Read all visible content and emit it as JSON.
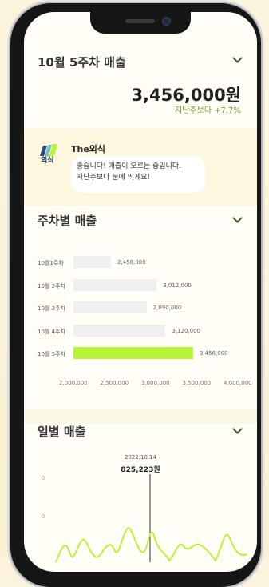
{
  "weekly_summary": {
    "title": "10월 5주차 매출",
    "amount": "3,456,000원",
    "growth": "지난주보다 +7.7%"
  },
  "assistant": {
    "name": "The외식",
    "logo_text": "외식",
    "message_line1": "좋습니다! 매출이 오르는 중입니다.",
    "message_line2": "지난주보다 눈에 띄게요!"
  },
  "weekly_chart": {
    "title": "주차별 매출",
    "axis_ticks": [
      "2,000,000",
      "2,500,000",
      "3,000,000",
      "3,500,000",
      "4,000,000"
    ],
    "highlight_color": "#b8f53a",
    "bar_color": "#efefef"
  },
  "daily_chart": {
    "title": "일별 매출",
    "tooltip_date": "2022.10.14",
    "tooltip_value": "825,223원",
    "y_tick_1": "0",
    "y_tick_2": "0",
    "line_color": "#b8f53a"
  },
  "chart_data": {
    "type": "bar",
    "categories": [
      "10월1주차",
      "10월 2주차",
      "10월 3주차",
      "10월 4주차",
      "10월 5주차"
    ],
    "values": [
      2456000,
      3012000,
      2890000,
      3120000,
      3456000
    ],
    "value_labels": [
      "2,456,000",
      "3,012,000",
      "2,890,000",
      "3,120,000",
      "3,456,000"
    ],
    "title": "주차별 매출",
    "xlim": [
      2000000,
      4000000
    ]
  }
}
